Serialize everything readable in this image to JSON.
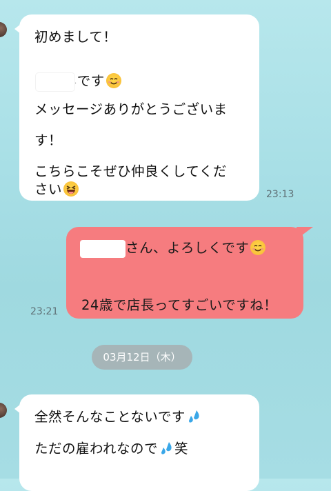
{
  "messages": [
    {
      "side": "in",
      "lines": [
        "初めまして！",
        "です",
        "メッセージありがとうございま",
        "す！",
        "こちらこそぜひ仲良くしてくだ",
        "さい"
      ],
      "time": "23:13"
    },
    {
      "side": "out",
      "lines": [
        "さん、よろしくです",
        "24歳で店長ってすごいですね！"
      ],
      "time": "23:21"
    },
    {
      "side": "in",
      "lines": [
        "全然そんなことないです",
        "ただの雇われなので",
        "笑"
      ]
    }
  ],
  "date_separator": "03月12日（木）",
  "icons": [
    "smile-emoji-icon",
    "laughing-emoji-icon",
    "sweat-droplets-icon",
    "avatar"
  ]
}
